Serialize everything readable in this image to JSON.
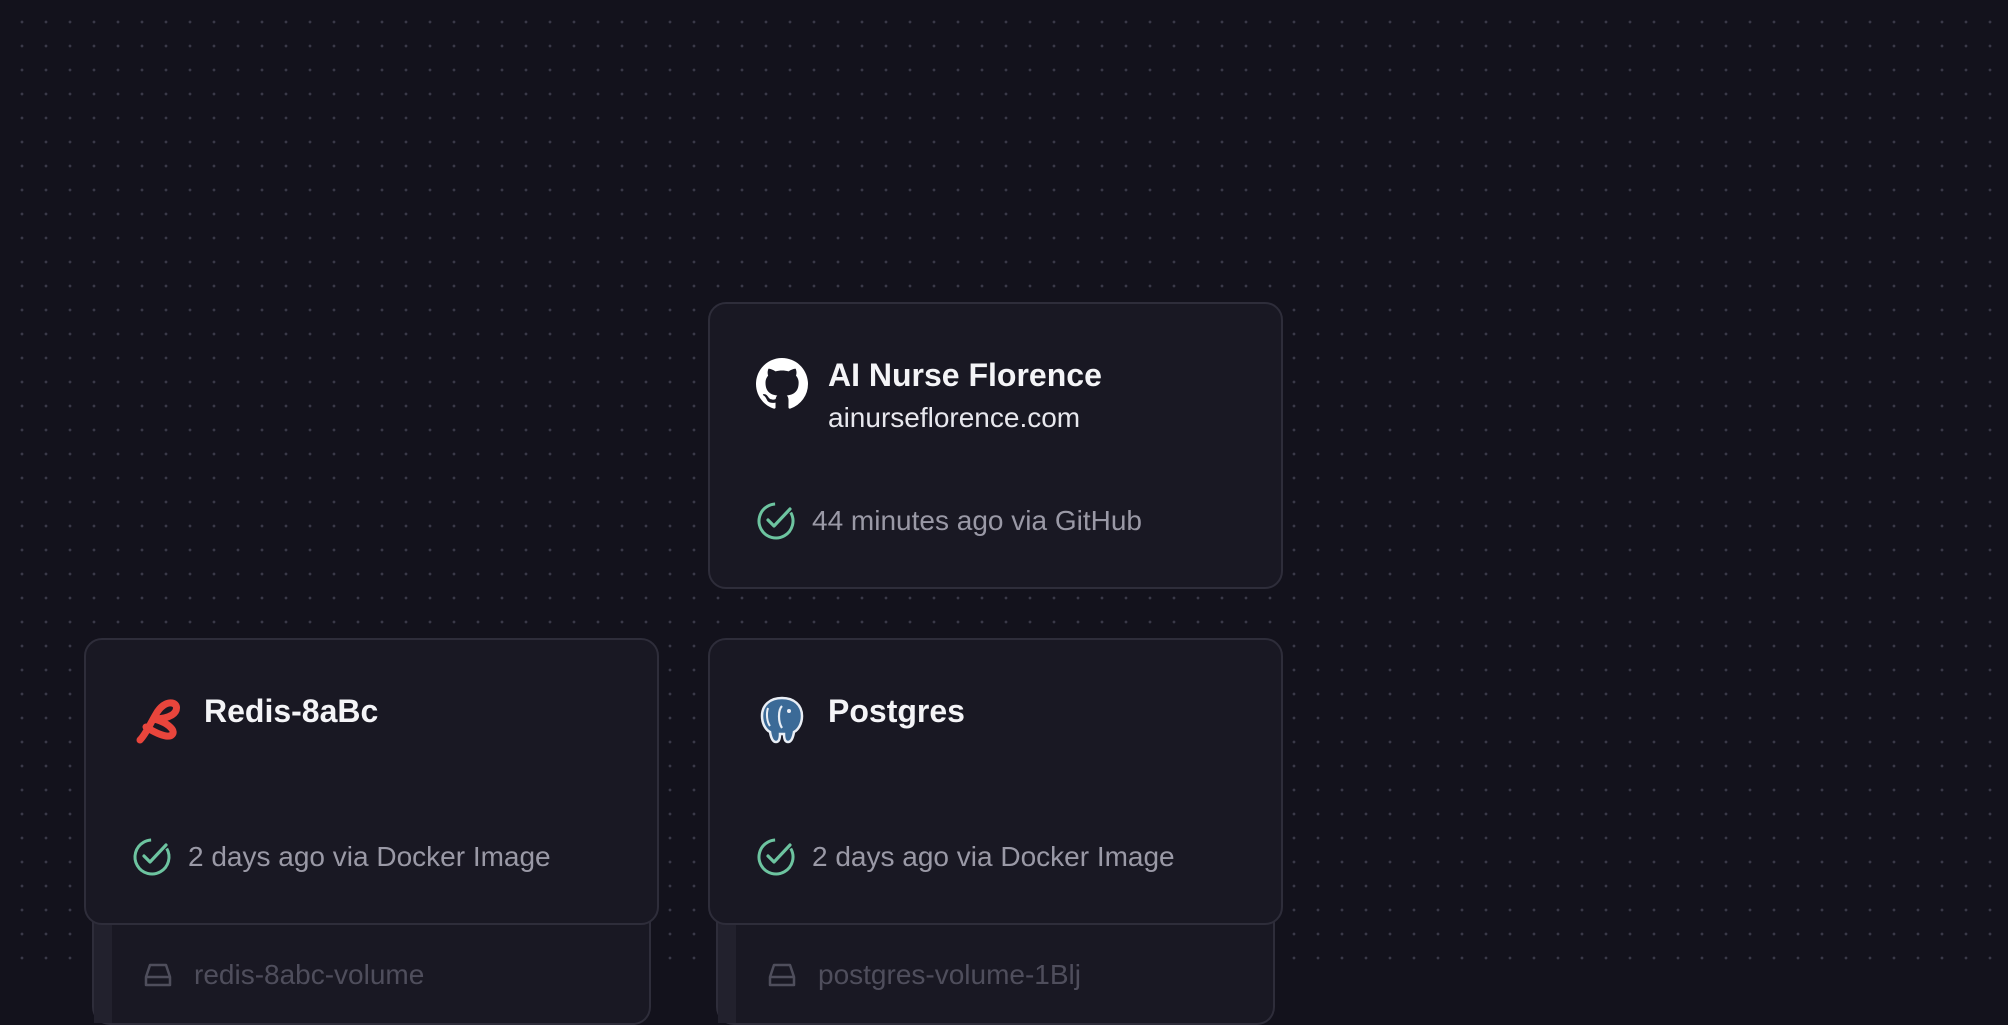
{
  "canvas": {
    "background_color": "#13121c",
    "dot_color": "#3a3948"
  },
  "services": {
    "github": {
      "title": "AI Nurse Florence",
      "domain": "ainurseflorence.com",
      "status": "44 minutes ago via GitHub",
      "icon": "github-icon"
    },
    "redis": {
      "title": "Redis-8aBc",
      "status": "2 days ago via Docker Image",
      "icon": "redis-icon",
      "volume": "redis-8abc-volume"
    },
    "postgres": {
      "title": "Postgres",
      "status": "2 days ago via Docker Image",
      "icon": "postgres-icon",
      "volume": "postgres-volume-1Blj"
    }
  },
  "colors": {
    "success": "#6dc4a0",
    "redis": "#e8453c",
    "postgres": "#3b6a97"
  }
}
